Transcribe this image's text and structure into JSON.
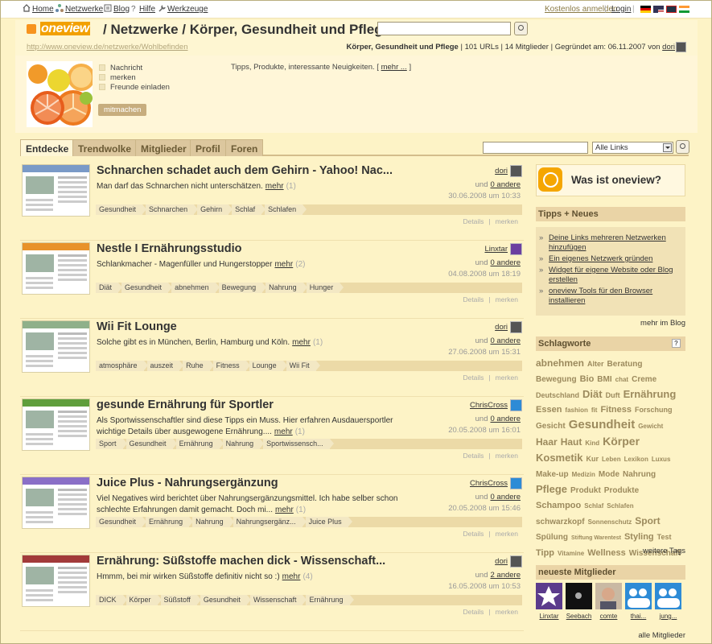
{
  "topnav": {
    "home": "Home",
    "netzwerke": "Netzwerke",
    "blog": "Blog",
    "hilfe": "Hilfe",
    "werkzeuge": "Werkzeuge",
    "signup": "Kostenlos anmelden",
    "login": "Login",
    "separator": "|"
  },
  "header": {
    "logo": "oneview",
    "title": "/ Netzwerke / Körper, Gesundheit und Pflege /",
    "url": "http://www.oneview.de/netzwerke/Wohlbefinden",
    "info_name": "Körper, Gesundheit und Pflege",
    "info_stats": "| 101 URLs | 14 Mitglieder | Gegründet am: 06.11.2007 von",
    "founder": "dori"
  },
  "sub": {
    "actions": [
      "Nachricht",
      "merken",
      "Freunde einladen"
    ],
    "description": "Tipps, Produkte, interessante Neuigkeiten. [",
    "description_more": "mehr ...",
    "description_close": "]",
    "join": "mitmachen"
  },
  "tabs": [
    "Entdecke",
    "Trendwolke",
    "Mitglieder",
    "Profil",
    "Foren"
  ],
  "filter": {
    "select": "Alle Links"
  },
  "items": [
    {
      "title": "Schnarchen schadet auch dem Gehirn - Yahoo! Nac...",
      "desc": "Man darf das Schnarchen nicht unterschätzen.",
      "more": "mehr",
      "count": "(1)",
      "user": "dori",
      "und": "und",
      "others": "0 andere",
      "date": "30.06.2008 um 10:33",
      "tags": [
        "Gesundheit",
        "Schnarchen",
        "Gehirn",
        "Schlaf",
        "Schlafen"
      ]
    },
    {
      "title": "Nestle I Ernährungsstudio",
      "desc": "Schlankmacher - Magenfüller und Hungerstopper",
      "more": "mehr",
      "count": "(2)",
      "user": "Linxtar",
      "und": "und",
      "others": "0 andere",
      "date": "04.08.2008 um 18:19",
      "tags": [
        "Diät",
        "Gesundheit",
        "abnehmen",
        "Bewegung",
        "Nahrung",
        "Hunger"
      ]
    },
    {
      "title": "Wii Fit Lounge",
      "desc": "Solche gibt es in München, Berlin, Hamburg und Köln.",
      "more": "mehr",
      "count": "(1)",
      "user": "dori",
      "und": "und",
      "others": "0 andere",
      "date": "27.06.2008 um 15:31",
      "tags": [
        "atmosphäre",
        "auszeit",
        "Ruhe",
        "Fitness",
        "Lounge",
        "Wii Fit"
      ]
    },
    {
      "title": "gesunde Ernährung für Sportler",
      "desc": "Als Sportwissenschaftler sind diese Tipps ein Muss. Hier erfahren Ausdauersportler wichtige Details über ausgewogene Ernährung....",
      "more": "mehr",
      "count": "(1)",
      "user": "ChrisCross",
      "und": "und",
      "others": "0 andere",
      "date": "20.05.2008 um 16:01",
      "tags": [
        "Sport",
        "Gesundheit",
        "Ernährung",
        "Nahrung",
        "Sportwissensch..."
      ]
    },
    {
      "title": "Juice Plus - Nahrungsergänzung",
      "desc": "Viel Negatives wird berichtet über Nahrungsergänzungsmittel. Ich habe selber schon schlechte Erfahrungen damit gemacht. Doch mi...",
      "more": "mehr",
      "count": "(1)",
      "user": "ChrisCross",
      "und": "und",
      "others": "0 andere",
      "date": "20.05.2008 um 15:46",
      "tags": [
        "Gesundheit",
        "Ernährung",
        "Nahrung",
        "Nahrungsergänz...",
        "Juice Plus"
      ]
    },
    {
      "title": "Ernährung: Süßstoffe machen dick - Wissenschaft...",
      "desc": "Hmmm, bei mir wirken Süßstoffe definitiv nicht so :)",
      "more": "mehr",
      "count": "(4)",
      "user": "dori",
      "und": "und",
      "others": "2 andere",
      "date": "16.05.2008 um 10:53",
      "tags": [
        "DICK",
        "Körper",
        "Süßstoff",
        "Gesundheit",
        "Wissenschaft",
        "Ernährung"
      ]
    }
  ],
  "item_links": {
    "details": "Details",
    "sep": "|",
    "merken": "merken"
  },
  "sidebar": {
    "what": "Was ist oneview?",
    "news_head": "Tipps + Neues",
    "news": [
      "Deine Links mehreren Netzwerken hinzufügen",
      "Ein eigenes Netzwerk gründen",
      "Widget für eigene Website oder Blog erstellen",
      "oneview Tools für den Browser installieren"
    ],
    "news_more": "mehr im Blog",
    "tags_head": "Schlagworte",
    "tags_help": "?",
    "tagcloud": [
      {
        "t": "abnehmen",
        "s": 12
      },
      {
        "t": "Alter",
        "s": 9
      },
      {
        "t": "Beratung",
        "s": 10
      },
      {
        "t": "Bewegung",
        "s": 10
      },
      {
        "t": "Bio",
        "s": 11
      },
      {
        "t": "BMI",
        "s": 10
      },
      {
        "t": "chat",
        "s": 8
      },
      {
        "t": "Creme",
        "s": 10
      },
      {
        "t": "Deutschland",
        "s": 9
      },
      {
        "t": "Diät",
        "s": 13
      },
      {
        "t": "Duft",
        "s": 9
      },
      {
        "t": "Ernährung",
        "s": 13
      },
      {
        "t": "Essen",
        "s": 11
      },
      {
        "t": "fashion",
        "s": 8
      },
      {
        "t": "fit",
        "s": 8
      },
      {
        "t": "Fitness",
        "s": 11
      },
      {
        "t": "Forschung",
        "s": 9
      },
      {
        "t": "Gesicht",
        "s": 10
      },
      {
        "t": "Gesundheit",
        "s": 15
      },
      {
        "t": "Gewicht",
        "s": 8
      },
      {
        "t": "Haar",
        "s": 12
      },
      {
        "t": "Haut",
        "s": 12
      },
      {
        "t": "Kind",
        "s": 8
      },
      {
        "t": "Körper",
        "s": 14
      },
      {
        "t": "Kosmetik",
        "s": 13
      },
      {
        "t": "Kur",
        "s": 9
      },
      {
        "t": "Leben",
        "s": 8
      },
      {
        "t": "Lexikon",
        "s": 8
      },
      {
        "t": "Luxus",
        "s": 8
      },
      {
        "t": "Make-up",
        "s": 10
      },
      {
        "t": "Medizin",
        "s": 8
      },
      {
        "t": "Mode",
        "s": 10
      },
      {
        "t": "Nahrung",
        "s": 10
      },
      {
        "t": "Pflege",
        "s": 13
      },
      {
        "t": "Produkt",
        "s": 10
      },
      {
        "t": "Produkte",
        "s": 10
      },
      {
        "t": "Schampoo",
        "s": 11
      },
      {
        "t": "Schlaf",
        "s": 8
      },
      {
        "t": "Schlafen",
        "s": 8
      },
      {
        "t": "schwarzkopf",
        "s": 10
      },
      {
        "t": "Sonnenschutz",
        "s": 8
      },
      {
        "t": "Sport",
        "s": 12
      },
      {
        "t": "Spülung",
        "s": 10
      },
      {
        "t": "Stiftung Warentest",
        "s": 7
      },
      {
        "t": "Styling",
        "s": 11
      },
      {
        "t": "Test",
        "s": 9
      },
      {
        "t": "Tipp",
        "s": 11
      },
      {
        "t": "Vitamine",
        "s": 8
      },
      {
        "t": "Wellness",
        "s": 11
      },
      {
        "t": "Wissenschaft",
        "s": 10
      }
    ],
    "tags_more": "weitere Tags",
    "members_head": "neueste Mitglieder",
    "members": [
      "Linxtar",
      "Seebach",
      "comte",
      "thai...",
      "jung..."
    ],
    "members_more": "alle Mitglieder"
  },
  "colors": {
    "accent": "#f2a000",
    "bg": "#fdf3c6",
    "tagbar": "#ecdaa7"
  }
}
